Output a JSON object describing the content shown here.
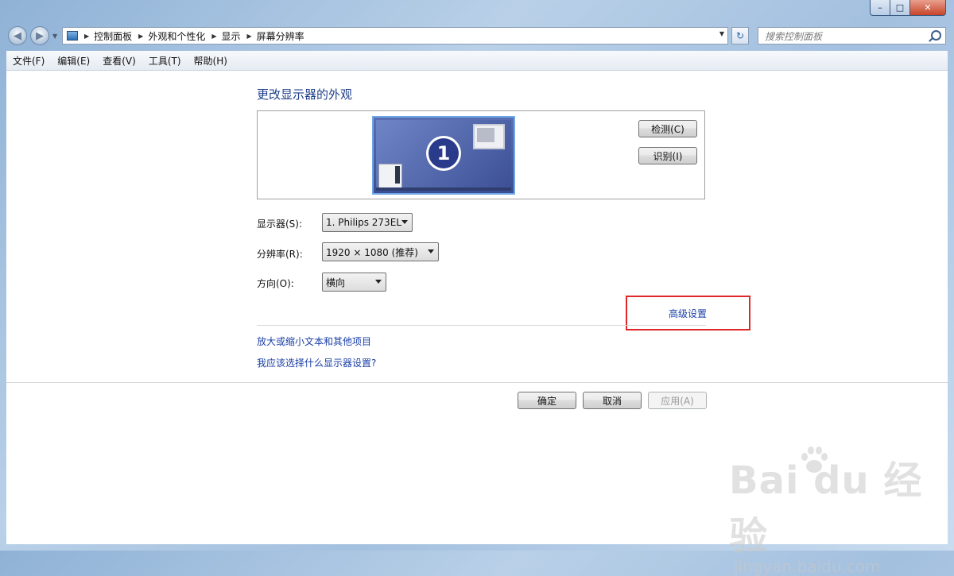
{
  "window": {
    "minimize_icon": "minimize-icon",
    "maximize_icon": "maximize-icon",
    "close_icon": "close-icon"
  },
  "nav": {
    "back_icon": "back-arrow-icon",
    "forward_icon": "forward-arrow-icon",
    "breadcrumb": [
      "控制面板",
      "外观和个性化",
      "显示",
      "屏幕分辨率"
    ],
    "search_placeholder": "搜索控制面板"
  },
  "menu": [
    "文件(F)",
    "编辑(E)",
    "查看(V)",
    "工具(T)",
    "帮助(H)"
  ],
  "main": {
    "heading": "更改显示器的外观",
    "monitor_number": "1",
    "detect_label": "检测(C)",
    "identify_label": "识别(I)",
    "display_label": "显示器(S):",
    "display_value": "1. Philips 273EL",
    "resolution_label": "分辨率(R):",
    "resolution_value": "1920 × 1080 (推荐)",
    "orientation_label": "方向(O):",
    "orientation_value": "横向",
    "advanced_link": "高级设置",
    "link_enlarge": "放大或缩小文本和其他项目",
    "link_which": "我应该选择什么显示器设置?"
  },
  "footer": {
    "ok": "确定",
    "cancel": "取消",
    "apply": "应用(A)"
  },
  "watermark": {
    "brand": "Bai  du 经验",
    "url": "jingyan.baidu.com"
  },
  "colors": {
    "link": "#1a3fa6",
    "heading": "#1e3f8a",
    "highlight": "#e02828"
  }
}
